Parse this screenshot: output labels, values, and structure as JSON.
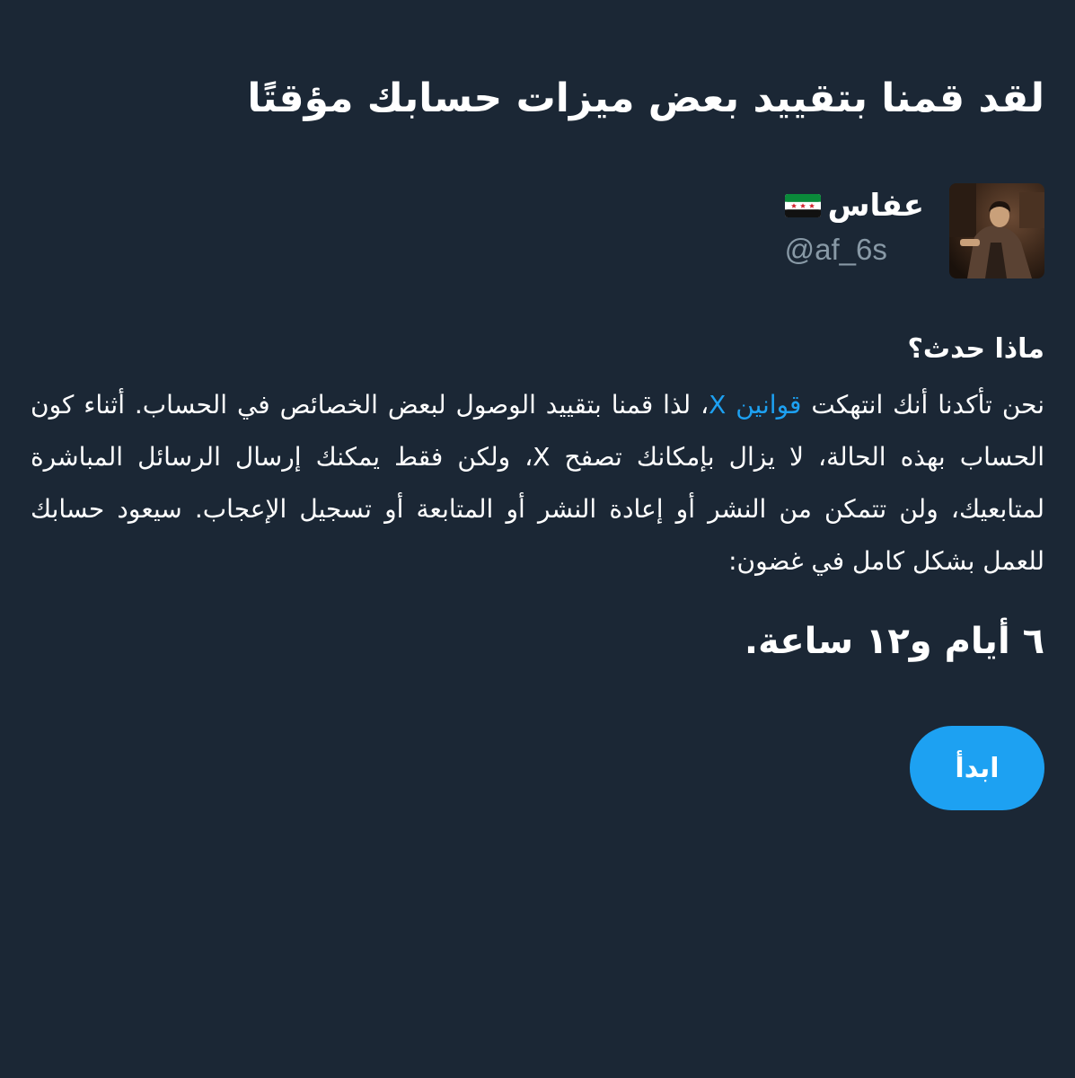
{
  "page": {
    "title": "لقد قمنا بتقييد بعض ميزات حسابك مؤقتًا"
  },
  "account": {
    "display_name": "عفاس",
    "flag_icon": "syrian-independence-flag-icon",
    "handle": "@af_6s",
    "avatar_icon": "profile-photo"
  },
  "notice": {
    "heading": "ماذا حدث؟",
    "body_prefix": "نحن تأكدنا أنك انتهكت ",
    "rules_link": "قوانين X",
    "body_suffix": "، لذا قمنا بتقييد الوصول لبعض الخصائص في الحساب. أثناء كون الحساب بهذه الحالة، لا يزال بإمكانك تصفح X، ولكن فقط يمكنك إرسال الرسائل المباشرة لمتابعيك، ولن تتمكن من النشر أو إعادة النشر أو المتابعة أو تسجيل الإعجاب. سيعود حسابك للعمل بشكل كامل في غضون:",
    "duration": "٦ أيام و١٢ ساعة."
  },
  "actions": {
    "start_label": "ابدأ"
  },
  "colors": {
    "background": "#1b2735",
    "text": "#ffffff",
    "secondary_text": "#8899a6",
    "accent": "#1da1f2"
  }
}
